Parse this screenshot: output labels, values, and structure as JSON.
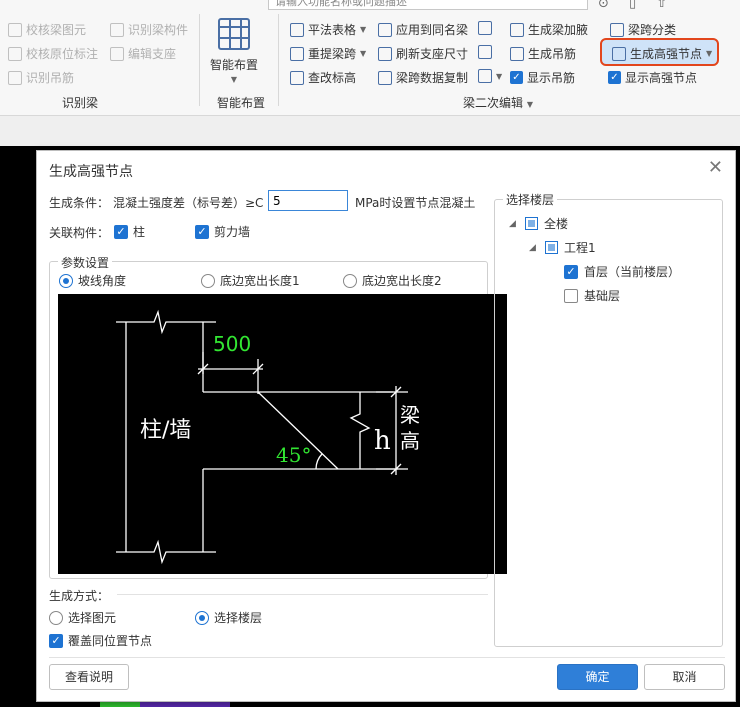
{
  "ribbon": {
    "search_placeholder": "请输入功能名称或问题描述",
    "group1": {
      "items": [
        "校核梁图元",
        "识别梁构件",
        "校核原位标注",
        "编辑支座",
        "识别吊筋"
      ],
      "label": "识别梁"
    },
    "group2": {
      "button": "智能布置",
      "label": "智能布置"
    },
    "group3": {
      "col1": [
        "平法表格",
        "重提梁跨",
        "查改标高"
      ],
      "col2": [
        "应用到同名梁",
        "刷新支座尺寸",
        "梁跨数据复制"
      ],
      "col3": [
        "生成梁加腋",
        "生成吊筋",
        "显示吊筋"
      ],
      "col4": [
        "梁跨分类",
        "生成高强节点",
        "显示高强节点"
      ],
      "label": "梁二次编辑"
    }
  },
  "dialog": {
    "title": "生成高强节点",
    "condition_label": "生成条件：",
    "condition_text": "混凝土强度差（标号差）≥C",
    "condition_value": "5",
    "condition_suffix": "MPa时设置节点混凝土",
    "related_label": "关联构件：",
    "related_items": [
      "柱",
      "剪力墙"
    ],
    "params_legend": "参数设置",
    "param_options": [
      "坡线角度",
      "底边宽出长度1",
      "底边宽出长度2"
    ],
    "drawing": {
      "dim_value": "500",
      "angle_value": "45°",
      "column_label": "柱/墙",
      "beam_label_1": "梁",
      "beam_label_2": "高",
      "h_label": "h"
    },
    "gen_mode_label": "生成方式：",
    "gen_mode_options": [
      "选择图元",
      "选择楼层"
    ],
    "overwrite_label": "覆盖同位置节点",
    "floor_section_title": "选择楼层",
    "floor_tree": [
      "全楼",
      "工程1",
      "首层（当前楼层）",
      "基础层"
    ],
    "buttons": {
      "help": "查看说明",
      "ok": "确定",
      "cancel": "取消"
    }
  }
}
